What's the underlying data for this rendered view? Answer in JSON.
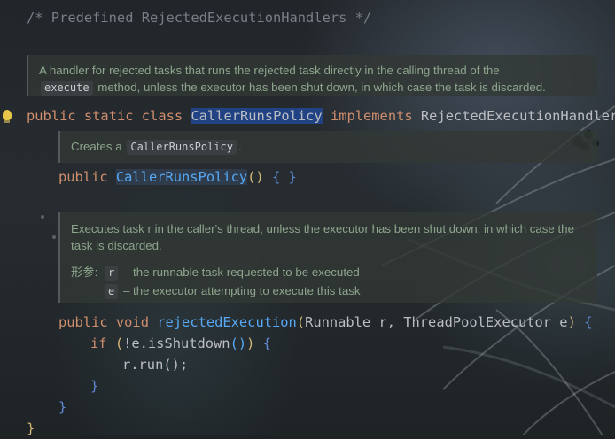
{
  "code": {
    "header_comment": "/* Predefined RejectedExecutionHandlers */",
    "class_line": {
      "kw1": "public",
      "kw2": "static",
      "kw3": "class",
      "name": "CallerRunsPolicy",
      "kw4": "implements",
      "iface": "RejectedExecutionHandler",
      "brace": "{"
    },
    "ctor_line": {
      "kw": "public",
      "name": "CallerRunsPolicy",
      "parens": "()",
      "body": "{ }"
    },
    "method_line": {
      "kw1": "public",
      "kw2": "void",
      "name": "rejectedExecution",
      "open": "(",
      "params": "Runnable r, ThreadPoolExecutor e",
      "close": ")",
      "brace": "{"
    },
    "if_line": {
      "kw": "if",
      "paren_open": "(",
      "cond": "!e.isShutdown",
      "call": "()",
      "paren_close": ")",
      "brace": "{"
    },
    "run_line": "r.run();",
    "close_if": "}",
    "close_method": "}",
    "close_class": "}"
  },
  "docs": {
    "class_doc": {
      "text1": "A handler for rejected tasks that runs the rejected task directly in the calling thread of the",
      "chip": "execute",
      "text2": "method, unless the executor has been shut down, in which case the task is discarded."
    },
    "ctor_doc": {
      "text": "Creates a",
      "chip": "CallerRunsPolicy",
      "tail": "."
    },
    "method_doc": {
      "text": "Executes task r in the caller's thread, unless the executor has been shut down, in which case the task is discarded.",
      "params_label": "形参:",
      "param_r_name": "r",
      "param_r_desc": "– the runnable task requested to be executed",
      "param_e_name": "e",
      "param_e_desc": "– the executor attempting to execute this task"
    }
  },
  "colors": {
    "keyword": "#cf8e6d",
    "function": "#56a8f5",
    "comment": "#7a7e85",
    "doc_text": "#8da58d",
    "selection": "#214283",
    "bulb": "#e8c64a"
  },
  "icons": {
    "gutter": "lightbulb-icon"
  }
}
